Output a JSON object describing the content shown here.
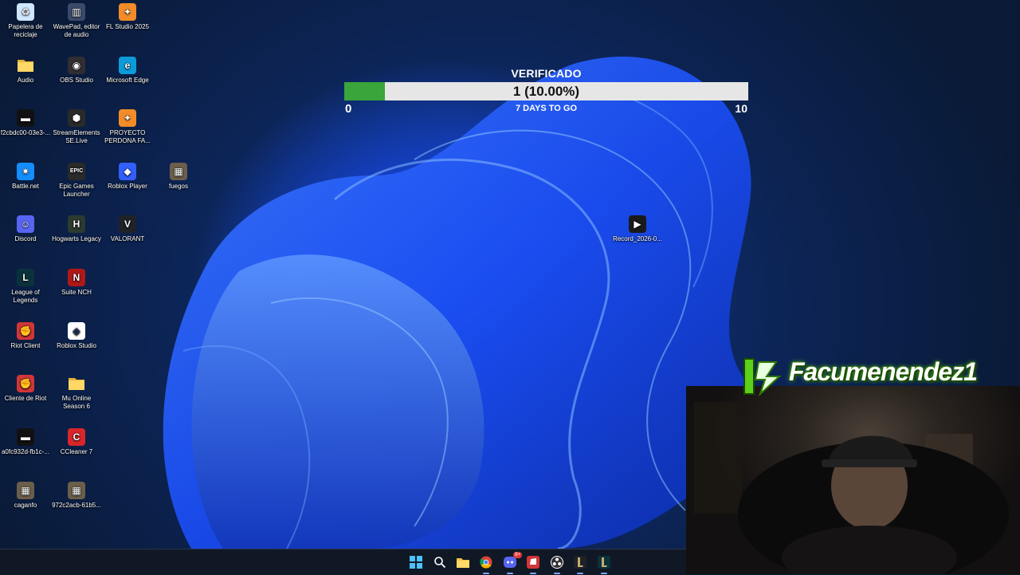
{
  "desktop_icons": [
    {
      "label": "Papelera de reciclaje",
      "icon": "recycle-bin-icon"
    },
    {
      "label": "WavePad, editor de audio",
      "icon": "wavepad-icon"
    },
    {
      "label": "FL Studio 2025",
      "icon": "fl-studio-icon"
    },
    {
      "label": "Audio",
      "icon": "folder-icon"
    },
    {
      "label": "OBS Studio",
      "icon": "obs-icon"
    },
    {
      "label": "Microsoft Edge",
      "icon": "edge-icon"
    },
    {
      "label": "f2cbdc00-03e3-...",
      "icon": "file-icon"
    },
    {
      "label": "StreamElements SE.Live",
      "icon": "streamelements-icon"
    },
    {
      "label": "PROYECTO PERDONA FA...",
      "icon": "fl-project-icon"
    },
    {
      "label": "Battle.net",
      "icon": "battlenet-icon"
    },
    {
      "label": "Epic Games Launcher",
      "icon": "epic-games-icon"
    },
    {
      "label": "Roblox Player",
      "icon": "roblox-icon"
    },
    {
      "label": "fuegos",
      "icon": "image-file-icon"
    },
    {
      "label": "Discord",
      "icon": "discord-icon"
    },
    {
      "label": "Hogwarts Legacy",
      "icon": "hogwarts-icon"
    },
    {
      "label": "VALORANT",
      "icon": "valorant-icon"
    },
    {
      "label": "League of Legends",
      "icon": "league-icon"
    },
    {
      "label": "Suite NCH",
      "icon": "nch-icon"
    },
    {
      "label": "Riot Client",
      "icon": "riot-icon"
    },
    {
      "label": "Roblox Studio",
      "icon": "roblox-studio-icon"
    },
    {
      "label": "Cliente de Riot",
      "icon": "riot-icon"
    },
    {
      "label": "Mu Online Season 6",
      "icon": "folder-icon"
    },
    {
      "label": "a0fc932d-fb1c-...",
      "icon": "file-icon"
    },
    {
      "label": "CCleaner 7",
      "icon": "ccleaner-icon"
    },
    {
      "label": "caganfo",
      "icon": "image-file-icon"
    },
    {
      "label": "972c2acb-61b5...",
      "icon": "image-file-icon"
    },
    {
      "label": "Record_2026-0...",
      "icon": "video-file-icon"
    }
  ],
  "goal": {
    "title": "VERIFICADO",
    "value": "1 (10.00%)",
    "progress": 0.1,
    "min": "0",
    "max": "10",
    "days": "7 DAYS TO GO"
  },
  "overlay": {
    "streamer_name": "Facumenendez1"
  },
  "taskbar": {
    "icons": [
      "windows-start-icon",
      "search-icon",
      "file-explorer-icon",
      "chrome-icon",
      "discord-icon",
      "riot-icon",
      "obs-icon",
      "league-icon",
      "league-icon"
    ],
    "discord_badge": "9+"
  },
  "colors": {
    "progress_fill": "#3aa53a",
    "progress_track": "#e6e6e6",
    "accent_green": "#5bd11a"
  }
}
